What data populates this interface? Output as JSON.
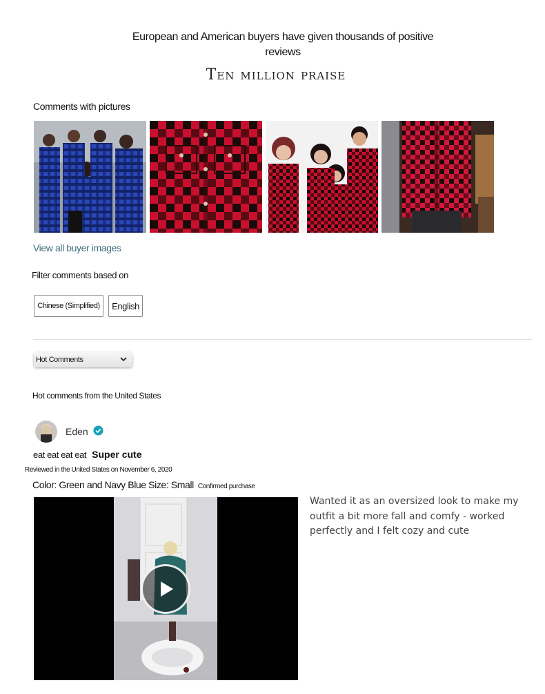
{
  "hero": {
    "title": "European and American buyers have given thousands of positive reviews",
    "subtitle": "Ten million praise"
  },
  "gallery": {
    "heading": "Comments with pictures",
    "view_all_label": "View all buyer images",
    "images": [
      {
        "icon": "family-blue-plaid-photo"
      },
      {
        "icon": "red-plaid-shirt-closeup-photo"
      },
      {
        "icon": "group-red-plaid-photo"
      },
      {
        "icon": "red-plaid-shirt-worn-photo"
      }
    ]
  },
  "filter": {
    "heading": "Filter comments based on",
    "languages": [
      "Chinese (Simplified)",
      "English"
    ]
  },
  "sort": {
    "selected": "Hot Comments",
    "region_heading": "Hot comments from the United States"
  },
  "review": {
    "reviewer": "Eden",
    "verified_icon": "verified-check-icon",
    "title_prefix": "eat eat eat eat",
    "title": "Super cute",
    "meta": "Reviewed in the United States on November 6, 2020",
    "variant": "Color: Green and Navy Blue Size: Small",
    "badge": "Confirmed purchase",
    "body": "Wanted it as an oversized look to make my outfit a bit more fall and comfy - worked perfectly and I felt cozy and cute"
  },
  "colors": {
    "link": "#3f6f7f",
    "verified": "#1aa3b8",
    "divider": "#dddddd"
  }
}
